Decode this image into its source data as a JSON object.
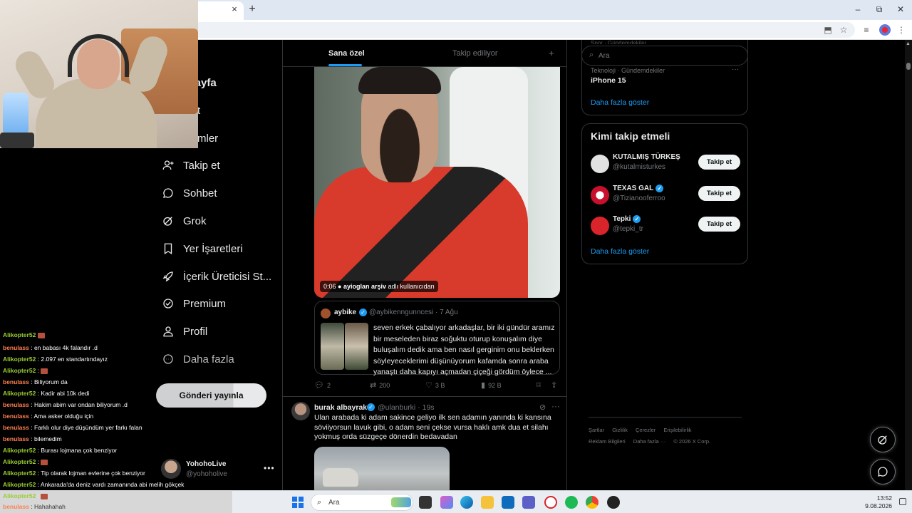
{
  "browser": {
    "tab_close": "×",
    "new_tab": "+",
    "window_controls": [
      "–",
      "⧉",
      "✕"
    ]
  },
  "nav": {
    "items": [
      {
        "label": "asayfa",
        "icon": "home-icon"
      },
      {
        "label": "sfet",
        "icon": "search-icon"
      },
      {
        "label": "dirimler",
        "icon": "bell-icon"
      },
      {
        "label": "Takip et",
        "icon": "add-person-icon"
      },
      {
        "label": "Sohbet",
        "icon": "chat-icon"
      },
      {
        "label": "Grok",
        "icon": "grok-icon"
      },
      {
        "label": "Yer İşaretleri",
        "icon": "bookmark-icon"
      },
      {
        "label": "İçerik Üreticisi St...",
        "icon": "rocket-icon"
      },
      {
        "label": "Premium",
        "icon": "verified-icon"
      },
      {
        "label": "Profil",
        "icon": "person-icon"
      },
      {
        "label": "Daha fazla",
        "icon": "more-circle-icon"
      }
    ],
    "post_button": "Gönderi yayınla",
    "account": {
      "name": "YohohoLive",
      "handle": "@yohoholive",
      "more": "•••"
    }
  },
  "chat": [
    {
      "user": "Alikopter52",
      "text": ""
    },
    {
      "user": "benulass",
      "text": ": en babası 4k falandır .d"
    },
    {
      "user": "Alikopter52",
      "text": ": 2.097 en standartındayız"
    },
    {
      "user": "Alikopter52",
      "text": ": "
    },
    {
      "user": "benulass",
      "text": ": Biliyorum da"
    },
    {
      "user": "Alikopter52",
      "text": ": Kadir abi 10k dedi"
    },
    {
      "user": "benulass",
      "text": ": Hakim abim var ondan biliyorum .d"
    },
    {
      "user": "benulass",
      "text": ": Ama asker olduğu için"
    },
    {
      "user": "benulass",
      "text": ": Farklı olur diye düşündüm yer farkı falan"
    },
    {
      "user": "benulass",
      "text": ": bilemedim"
    },
    {
      "user": "Alikopter52",
      "text": ": Burası lojmana çok benziyor"
    },
    {
      "user": "Alikopter52",
      "text": ": "
    },
    {
      "user": "Alikopter52",
      "text": ": Tip olarak lojman evlerine çok benziyor"
    },
    {
      "user": "Alikopter52",
      "text": ": Ankarada'da deniz vardı zamanında abi melih gökçek"
    },
    {
      "user": "Alikopter52",
      "text": ": "
    },
    {
      "user": "benulass",
      "text": ": Hahahahah"
    }
  ],
  "timeline": {
    "tabs": {
      "for_you": "Sana özel",
      "following": "Takip ediliyor",
      "add": "+"
    },
    "video_overlay": {
      "time": "0:06",
      "source_name": "ayioglan arşiv",
      "source_suffix": "adlı kullanıcıdan"
    },
    "quote": {
      "name": "aybike",
      "meta": "@aybikenngunncesi · 7 Ağu",
      "text": "seven erkek çabalıyor arkadaşlar, bir iki gündür aramız bir meseleden biraz soğuktu oturup konuşalım diye buluşalım dedik ama ben nasıl gerginim onu beklerken söyleyeceklerimi düşünüyorum kafamda sonra araba yanaştı daha kapıyı açmadan çiçeği gördüm öylece ..."
    },
    "actions": {
      "replies": "2",
      "reposts": "200",
      "likes": "3 B",
      "views": "92 B"
    },
    "post2": {
      "name": "burak albayrak",
      "meta": "@ulanburki · 19s",
      "text": "Ulan arabada ki adam sakince geliyo ilk sen adamın yanında ki kansına söviiyorsun lavuk gibi, o adam seni çekse vursa haklı amk dua et silahı yokmuş orda süzgeçe dönerdin bedavadan"
    }
  },
  "sidebar": {
    "search_placeholder": "Ara",
    "trend_top_category": "Spor · Gündemdekiler",
    "trend_category": "Teknoloji · Gündemdekiler",
    "trend_title": "iPhone 15",
    "show_more": "Daha fazla göster",
    "who_to_follow_title": "Kimi takip etmeli",
    "follow_suggestions": [
      {
        "name": "KUTALMIŞ TÜRKEŞ",
        "handle": "@kutalmisturkes",
        "verified": false,
        "button": "Takip et",
        "avatar_color": "#dcdcdc"
      },
      {
        "name": "TEXAS GAL",
        "handle": "@Tizianooferroo",
        "verified": true,
        "button": "Takip et",
        "avatar_color": "#c8102e"
      },
      {
        "name": "Tepki",
        "handle": "@tepki_tr",
        "verified": true,
        "button": "Takip et",
        "avatar_color": "#d9242b"
      }
    ],
    "footer": [
      "Şartlar",
      "Gizlilik",
      "Çerezler",
      "Erişilebilirlik",
      "Reklam Bilgileri",
      "Daha fazla ···",
      "© 2026 X Corp."
    ]
  },
  "taskbar": {
    "search_placeholder": "Ara",
    "time": "13:52",
    "date": "9.08.2026"
  },
  "colors": {
    "accent": "#1d9bf0",
    "background": "#000000",
    "chat_user_orange": "#ff7f50",
    "chat_user_green": "#9acd32"
  }
}
